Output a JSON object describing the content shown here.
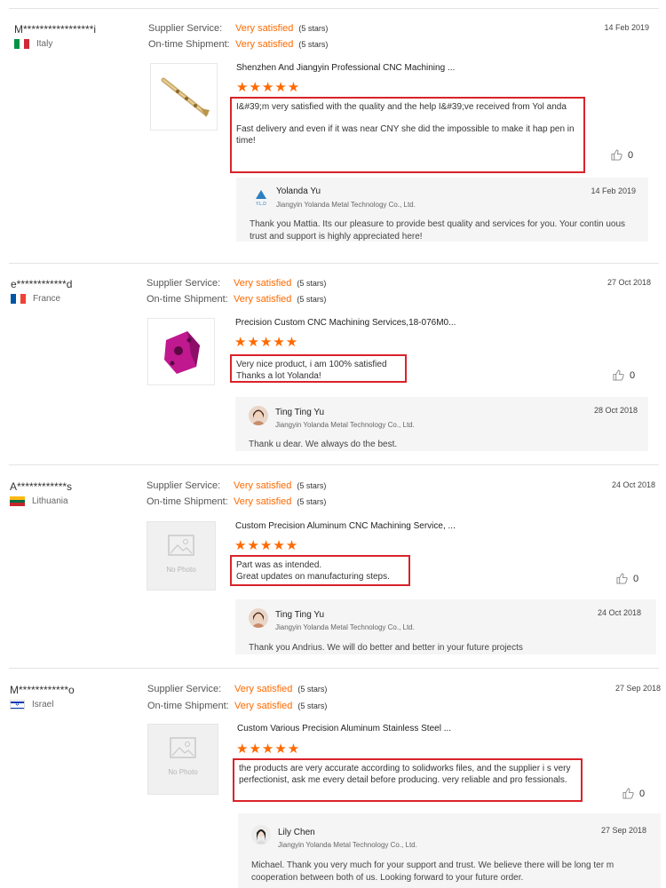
{
  "labels": {
    "supplier_service": "Supplier Service:",
    "on_time_shipment": "On-time Shipment:"
  },
  "colors": {
    "accent": "#ff6a00",
    "highlight_border": "#d9232a"
  },
  "reviews": [
    {
      "buyer": "M*****************i",
      "country": "Italy",
      "flag_icon": "italy-flag-icon",
      "supplier_service": "Very satisfied",
      "supplier_stars": "(5 stars)",
      "shipment": "Very satisfied",
      "shipment_stars": "(5 stars)",
      "date": "14 Feb 2019",
      "product": "Shenzhen And Jiangyin Professional CNC Machining ...",
      "rating": 5,
      "stars_text": "★★★★★",
      "comment_1": "I&#39;m very satisfied with the quality and the help I&#39;ve received from Yol anda",
      "comment_2": "Fast delivery and even if it was near CNY she did the impossible to make it hap pen in time!",
      "likes": "0",
      "reply": {
        "name": "Yolanda Yu",
        "company": "Jiangyin Yolanda Metal Technology Co., Ltd.",
        "date": "14 Feb 2019",
        "text": "Thank you Mattia. Its our pleasure to provide best quality and services for you. Your contin uous trust and support is highly appreciated here!"
      }
    },
    {
      "buyer": "e************d",
      "country": "France",
      "flag_icon": "france-flag-icon",
      "supplier_service": "Very satisfied",
      "supplier_stars": "(5 stars)",
      "shipment": "Very satisfied",
      "shipment_stars": "(5 stars)",
      "date": "27 Oct 2018",
      "product": "Precision Custom CNC Machining Services,18-076M0...",
      "rating": 5,
      "stars_text": "★★★★★",
      "comment_1": "Very nice product, i am 100% satisfied",
      "comment_2": "Thanks a lot Yolanda!",
      "likes": "0",
      "reply": {
        "name": "Ting Ting Yu",
        "company": "Jiangyin Yolanda Metal Technology Co., Ltd.",
        "date": "28 Oct 2018",
        "text": "Thank u dear. We always do the best."
      }
    },
    {
      "buyer": "A************s",
      "country": "Lithuania",
      "flag_icon": "lithuania-flag-icon",
      "supplier_service": "Very satisfied",
      "supplier_stars": "(5 stars)",
      "shipment": "Very satisfied",
      "shipment_stars": "(5 stars)",
      "date": "24 Oct 2018",
      "product": "Custom Precision Aluminum CNC Machining Service, ...",
      "rating": 5,
      "stars_text": "★★★★★",
      "no_photo": "No Photo",
      "comment_1": "Part was as intended.",
      "comment_2": "Great updates on manufacturing steps.",
      "likes": "0",
      "reply": {
        "name": "Ting Ting Yu",
        "company": "Jiangyin Yolanda Metal Technology Co., Ltd.",
        "date": "24 Oct 2018",
        "text": "Thank you Andrius. We will do better and better in your future projects"
      }
    },
    {
      "buyer": "M************o",
      "country": "Israel",
      "flag_icon": "israel-flag-icon",
      "supplier_service": "Very satisfied",
      "supplier_stars": "(5 stars)",
      "shipment": "Very satisfied",
      "shipment_stars": "(5 stars)",
      "date": "27 Sep 2018",
      "product": "Custom Various Precision Aluminum Stainless Steel ...",
      "rating": 5,
      "stars_text": "★★★★★",
      "no_photo": "No Photo",
      "comment_1": "the products are very accurate according to solidworks files, and the supplier i s very perfectionist, ask me every detail before producing. very reliable and pro fessionals.",
      "likes": "0",
      "reply": {
        "name": "Lily Chen",
        "company": "Jiangyin Yolanda Metal Technology Co., Ltd.",
        "date": "27 Sep 2018",
        "text": "Michael. Thank you very much for your support and trust. We believe there will be long ter m cooperation between both of us. Looking forward to your future order."
      }
    }
  ]
}
